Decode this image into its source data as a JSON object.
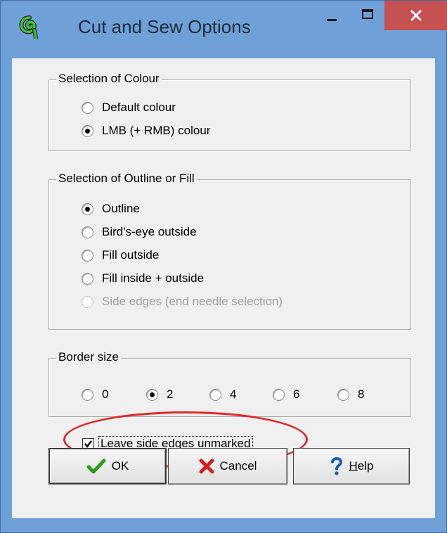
{
  "window": {
    "title": "Cut and Sew Options",
    "icon": "spiral-app-icon",
    "controls": [
      "minimize-icon",
      "maximize-icon",
      "close-icon"
    ],
    "accent": "#6fa1d8",
    "close_color": "#c75050"
  },
  "colour_group": {
    "legend": "Selection of Colour",
    "options": [
      {
        "label": "Default colour",
        "selected": false
      },
      {
        "label": "LMB (+ RMB) colour",
        "selected": true
      }
    ]
  },
  "outline_group": {
    "legend": "Selection of Outline or Fill",
    "options": [
      {
        "label": "Outline",
        "selected": true,
        "enabled": true
      },
      {
        "label": "Bird's-eye outside",
        "selected": false,
        "enabled": true
      },
      {
        "label": "Fill outside",
        "selected": false,
        "enabled": true
      },
      {
        "label": "Fill inside + outside",
        "selected": false,
        "enabled": true
      },
      {
        "label": "Side edges (end needle selection)",
        "selected": false,
        "enabled": false
      }
    ]
  },
  "border_group": {
    "legend": "Border size",
    "options": [
      {
        "label": "0",
        "selected": false
      },
      {
        "label": "2",
        "selected": true
      },
      {
        "label": "4",
        "selected": false
      },
      {
        "label": "6",
        "selected": false
      },
      {
        "label": "8",
        "selected": false
      }
    ]
  },
  "leave_side_edges": {
    "label": "Leave side edges unmarked",
    "checked": true,
    "highlight_color": "#e0282a"
  },
  "buttons": {
    "ok": {
      "label": "OK",
      "icon": "checkmark-icon"
    },
    "cancel": {
      "label": "Cancel",
      "icon": "red-x-icon"
    },
    "help": {
      "label_prefix": "",
      "label_underlined": "H",
      "label_rest": "elp",
      "icon": "question-mark-icon"
    }
  }
}
